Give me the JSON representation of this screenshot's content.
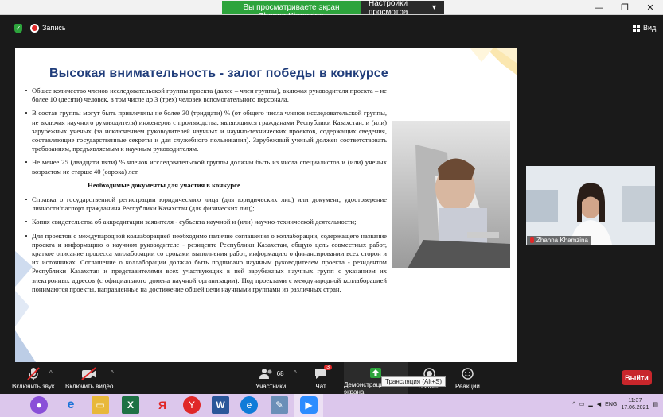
{
  "share_banner": {
    "text": "Вы просматриваете экран Zhanna Khamzina",
    "view_options": "Настройки просмотра"
  },
  "window_controls": {
    "minimize": "—",
    "maximize": "❐",
    "close": "✕"
  },
  "top_bar": {
    "record_label": "Запись",
    "view_label": "Вид"
  },
  "slide": {
    "title": "Высокая внимательность - залог победы в конкурсе",
    "bullets_top": [
      "Общее количество членов исследовательской группы проекта (далее – член группы), включая руководителя проекта – не более 10 (десяти) человек, в том числе до 3 (трех) человек вспомогательного персонала.",
      "В состав группы могут быть привлечены не более 30 (тридцати) % (от общего числа членов исследовательской группы, не включая научного руководителя) инженеров с производства, являющихся гражданами Республики Казахстан, и (или) зарубежных ученых (за исключением руководителей научных и научно-технических проектов, содержащих сведения, составляющие государственные секреты и для служебного пользования). Зарубежный ученый должен соответствовать требованиям, предъявляемым к научным руководителям.",
      "Не менее 25 (двадцати пяти) % членов исследовательской группы должны быть из числа специалистов и (или) ученых возрастом не старше 40 (сорока) лет."
    ],
    "subheading": "Необходимые документы для участия в конкурсе",
    "bullets_bottom": [
      "Справка о государственной регистрации юридического лица (для юридических лиц) или документ, удостоверение личности/паспорт гражданина Республики Казахстан (для физических лиц);",
      "Копия свидетельства об аккредитации заявителя - субъекта научной и (или) научно-технической деятельности;",
      "Для проектов с международной коллаборацией необходимо наличие соглашения о коллаборации, содержащего название проекта и информацию о научном руководителе - резиденте Республики Казахстан, общую цель совместных работ, краткое описание процесса коллаборации со сроками выполнения работ, информацию о финансировании всех сторон и их источниках. Соглашение о коллаборации должно быть подписано научным руководителем проекта - резидентом Республики Казахстан и представителями всех участвующих в ней зарубежных научных групп с указанием их электронных адресов (с официального домена научной организации). Под проектами с международной коллаборацией понимаются проекты, направленные на достижение общей цели научными группами из различных стран."
    ]
  },
  "participant": {
    "name": "Zhanna Khamzina"
  },
  "toolbar": {
    "mute": "Включить звук",
    "video": "Включить видео",
    "participants": "Участники",
    "participants_count": "68",
    "chat": "Чат",
    "chat_badge": "3",
    "share": "Демонстрация экрана",
    "record": "Запись",
    "reactions": "Реакции",
    "leave": "Выйти",
    "tooltip": "Трансляция (Alt+S)"
  },
  "taskbar": {
    "lang": "ENG",
    "time": "11:37",
    "date": "17.06.2021"
  },
  "colors": {
    "title_blue": "#1f3c7a",
    "share_green": "#2da43c",
    "leave_red": "#c8262b",
    "taskbar_bg": "#dcc7ec"
  }
}
